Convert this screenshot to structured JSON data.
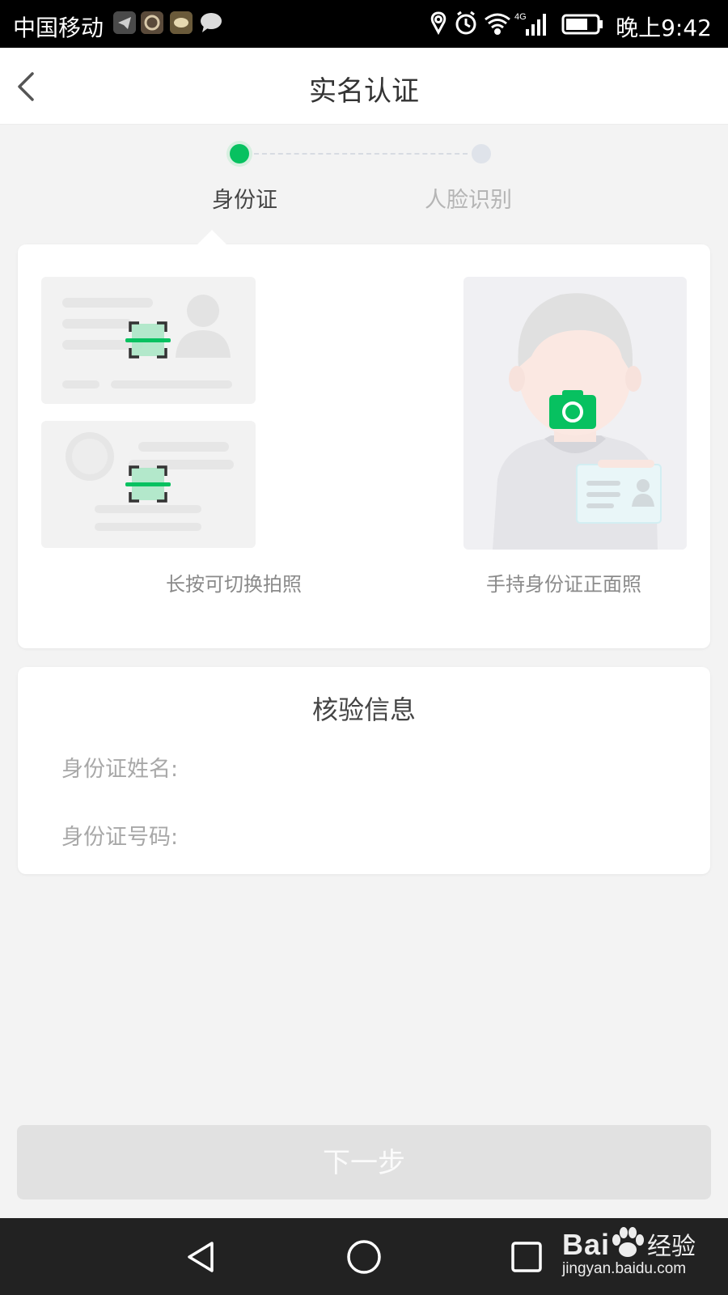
{
  "status_bar": {
    "carrier": "中国移动",
    "time": "晚上9:42",
    "network": "4G",
    "icons": [
      "telegram-icon",
      "app-icon",
      "app-icon",
      "chat-bubble-icon",
      "location-icon",
      "alarm-icon",
      "wifi-icon",
      "signal-icon",
      "battery-icon"
    ]
  },
  "header": {
    "title": "实名认证"
  },
  "stepper": {
    "steps": [
      {
        "label": "身份证",
        "active": true
      },
      {
        "label": "人脸识别",
        "active": false
      }
    ]
  },
  "photo_card": {
    "left_caption": "长按可切换拍照",
    "right_caption": "手持身份证正面照"
  },
  "verify_card": {
    "heading": "核验信息",
    "name_label": "身份证姓名:",
    "number_label": "身份证号码:"
  },
  "footer": {
    "next_label": "下一步"
  },
  "watermark": {
    "brand": "Bai",
    "brand_suffix": "经验",
    "site": "jingyan.baidu.com"
  },
  "colors": {
    "accent": "#07c160",
    "background": "#f3f3f3",
    "button_disabled": "#e1e1e1"
  }
}
